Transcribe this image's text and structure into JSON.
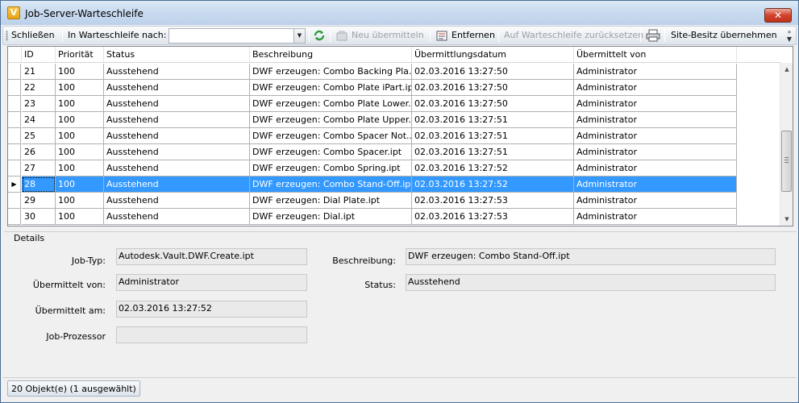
{
  "window": {
    "title": "Job-Server-Warteschleife",
    "app_icon_letter": "V",
    "close_glyph": "✕"
  },
  "toolbar": {
    "close_label": "Schließen",
    "queue_label": "In Warteschleife nach:",
    "queue_value": "",
    "resubmit_label": "Neu übermitteln",
    "remove_label": "Entfernen",
    "reset_label": "Auf Warteschleife zurücksetzen",
    "site_ownership_label": "Site-Besitz übernehmen"
  },
  "grid": {
    "columns": [
      "ID",
      "Priorität",
      "Status",
      "Beschreibung",
      "Übermittlungsdatum",
      "Übermittelt von"
    ],
    "rows": [
      {
        "id": "21",
        "priority": "100",
        "status": "Ausstehend",
        "description": "DWF erzeugen: Combo Backing Pla...",
        "date": "02.03.2016 13:27:50",
        "by": "Administrator",
        "selected": false
      },
      {
        "id": "22",
        "priority": "100",
        "status": "Ausstehend",
        "description": "DWF erzeugen: Combo Plate iPart.ipt",
        "date": "02.03.2016 13:27:50",
        "by": "Administrator",
        "selected": false
      },
      {
        "id": "23",
        "priority": "100",
        "status": "Ausstehend",
        "description": "DWF erzeugen: Combo Plate Lower...",
        "date": "02.03.2016 13:27:50",
        "by": "Administrator",
        "selected": false
      },
      {
        "id": "24",
        "priority": "100",
        "status": "Ausstehend",
        "description": "DWF erzeugen: Combo Plate Upper...",
        "date": "02.03.2016 13:27:51",
        "by": "Administrator",
        "selected": false
      },
      {
        "id": "25",
        "priority": "100",
        "status": "Ausstehend",
        "description": "DWF erzeugen: Combo Spacer Not...",
        "date": "02.03.2016 13:27:51",
        "by": "Administrator",
        "selected": false
      },
      {
        "id": "26",
        "priority": "100",
        "status": "Ausstehend",
        "description": "DWF erzeugen: Combo Spacer.ipt",
        "date": "02.03.2016 13:27:51",
        "by": "Administrator",
        "selected": false
      },
      {
        "id": "27",
        "priority": "100",
        "status": "Ausstehend",
        "description": "DWF erzeugen: Combo Spring.ipt",
        "date": "02.03.2016 13:27:52",
        "by": "Administrator",
        "selected": false
      },
      {
        "id": "28",
        "priority": "100",
        "status": "Ausstehend",
        "description": "DWF erzeugen: Combo Stand-Off.ipt",
        "date": "02.03.2016 13:27:52",
        "by": "Administrator",
        "selected": true
      },
      {
        "id": "29",
        "priority": "100",
        "status": "Ausstehend",
        "description": "DWF erzeugen: Dial Plate.ipt",
        "date": "02.03.2016 13:27:53",
        "by": "Administrator",
        "selected": false
      },
      {
        "id": "30",
        "priority": "100",
        "status": "Ausstehend",
        "description": "DWF erzeugen: Dial.ipt",
        "date": "02.03.2016 13:27:53",
        "by": "Administrator",
        "selected": false
      }
    ]
  },
  "details": {
    "title": "Details",
    "job_type_label": "Job-Typ:",
    "job_type_value": "Autodesk.Vault.DWF.Create.ipt",
    "submitted_by_label": "Übermittelt von:",
    "submitted_by_value": "Administrator",
    "submitted_at_label": "Übermittelt am:",
    "submitted_at_value": "02.03.2016 13:27:52",
    "processor_label": "Job-Prozessor",
    "processor_value": "",
    "description_label": "Beschreibung:",
    "description_value": "DWF erzeugen: Combo Stand-Off.ipt",
    "status_label": "Status:",
    "status_value": "Ausstehend"
  },
  "statusbar": {
    "text": "20 Objekt(e) (1 ausgewählt)"
  },
  "colors": {
    "selection": "#3399ff",
    "title_gradient_top": "#dce9f7",
    "close_button": "#d2422c"
  },
  "icons": {
    "refresh": "refresh-icon",
    "resubmit": "resubmit-icon",
    "remove": "remove-icon",
    "print": "print-icon",
    "row_indicator": "row-pointer-icon"
  },
  "scroll": {
    "position_fraction": 0.5
  }
}
